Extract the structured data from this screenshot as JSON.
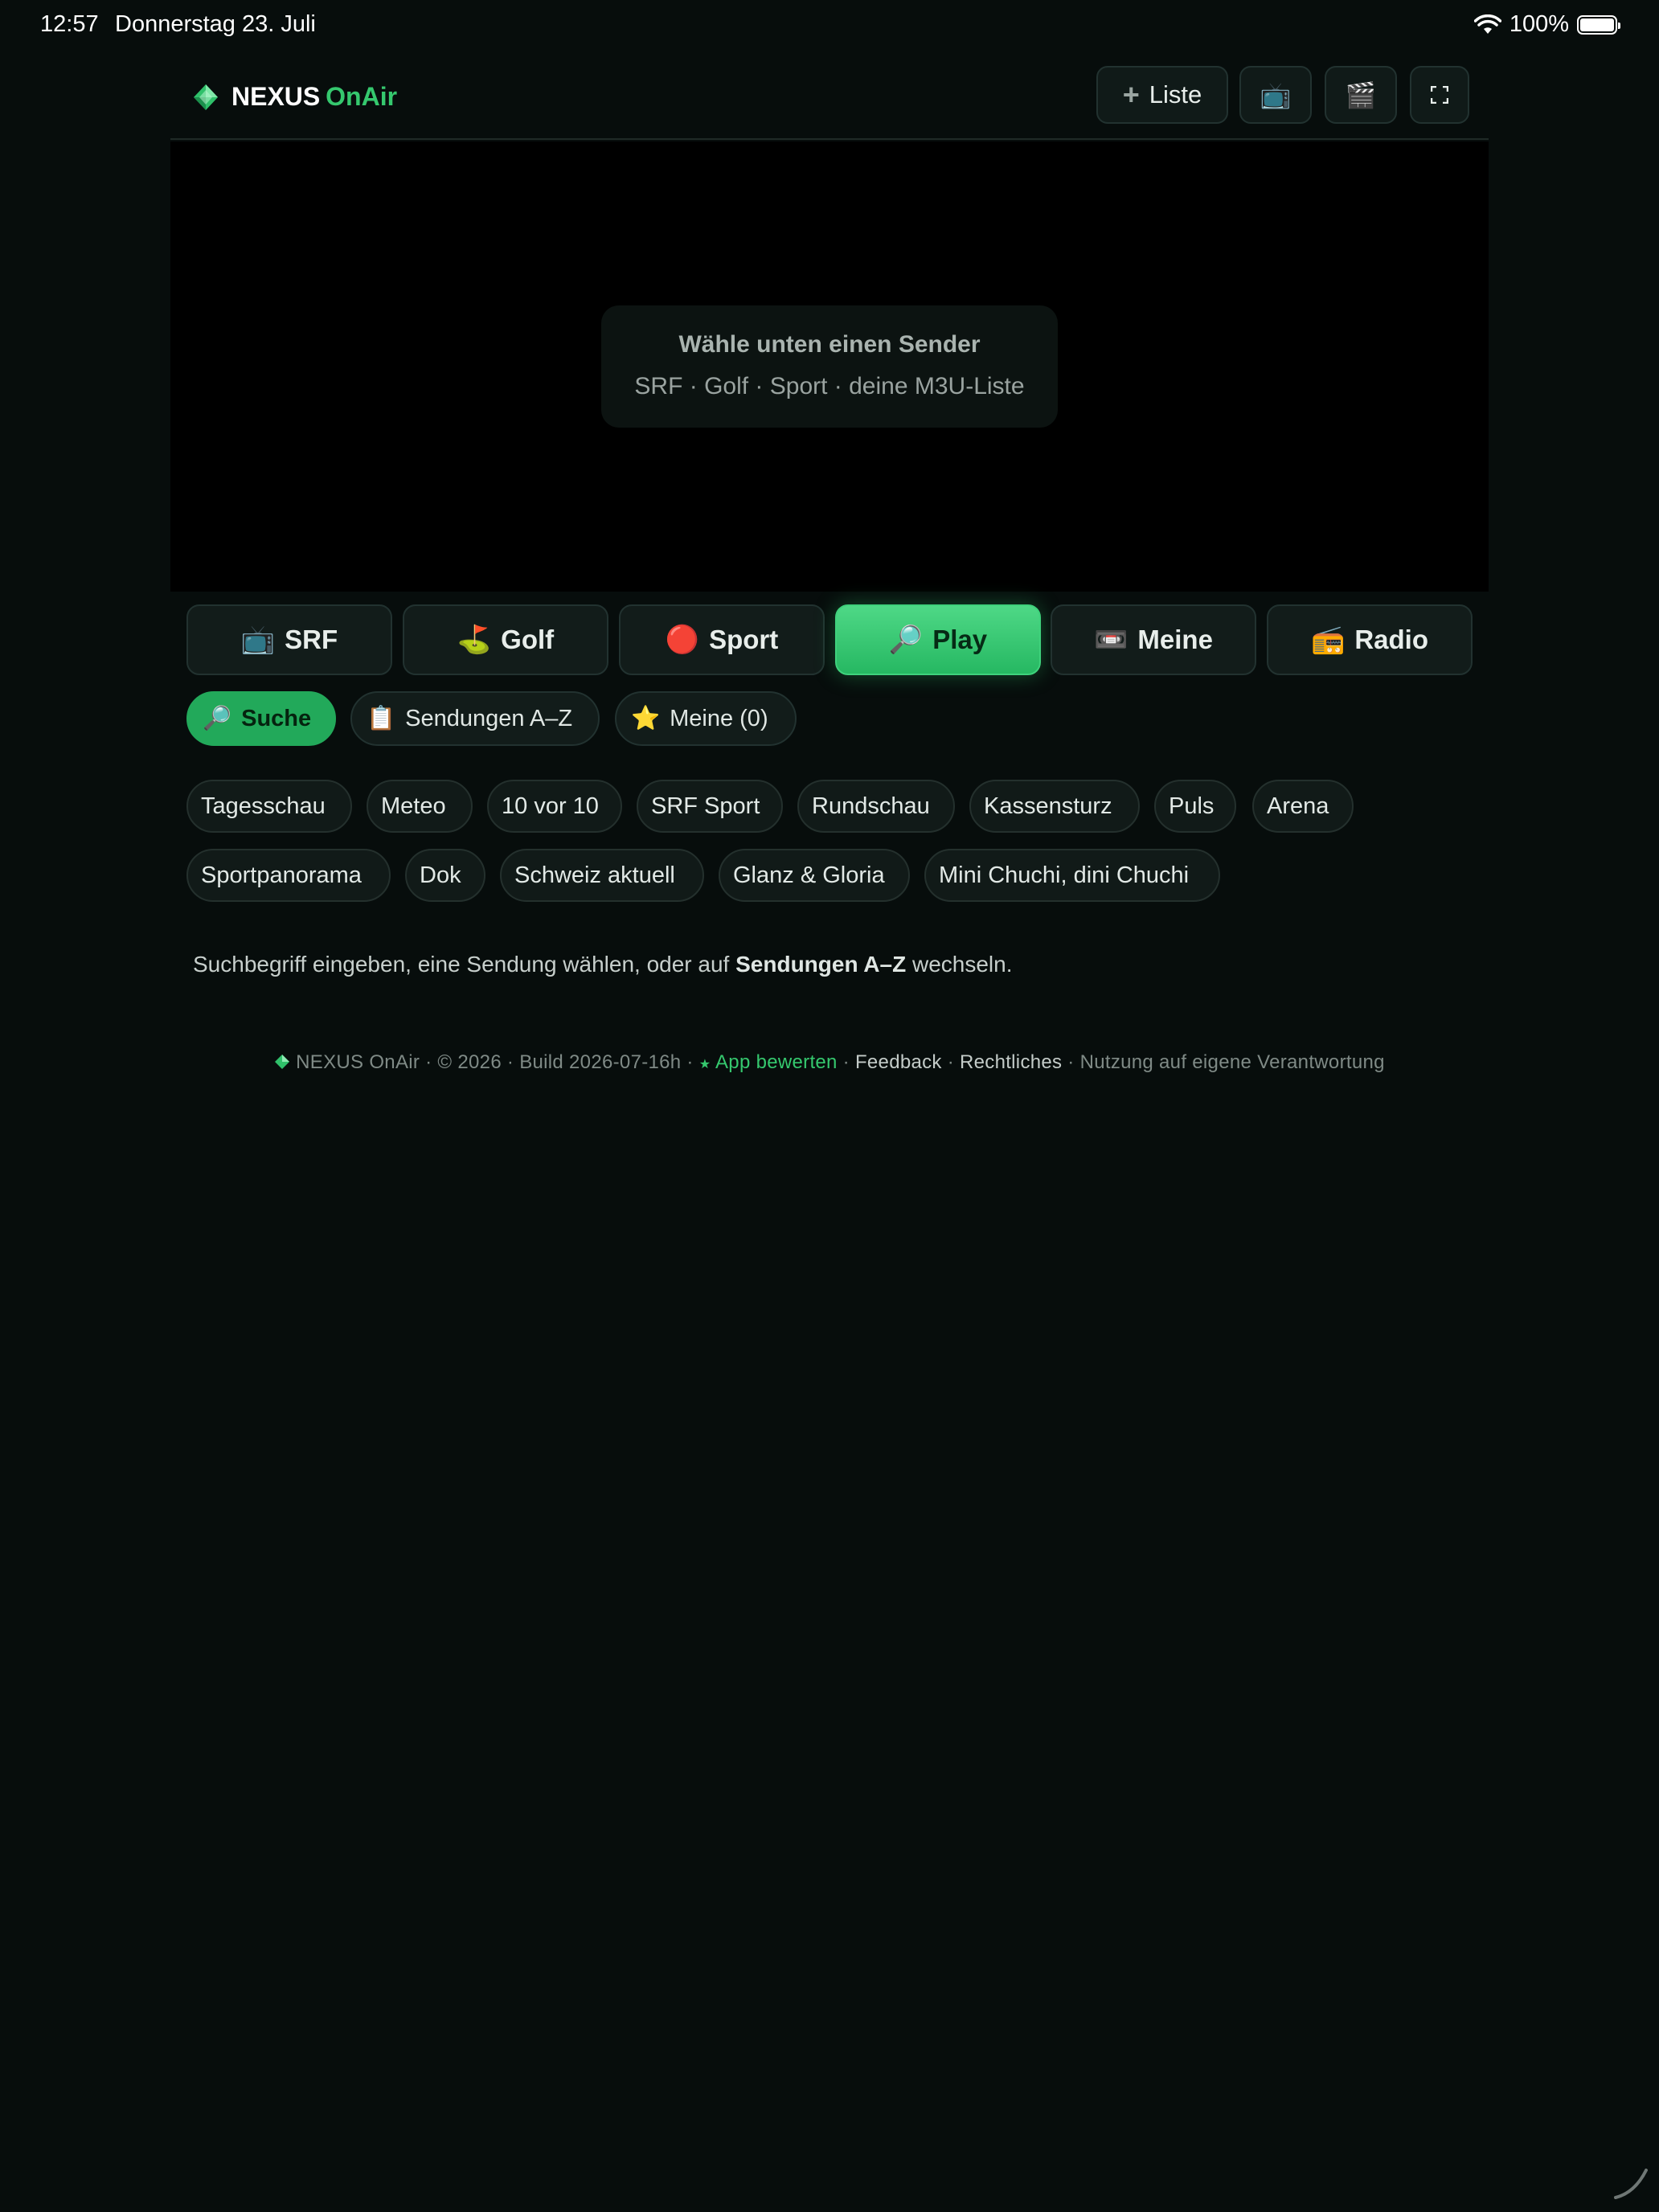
{
  "status_bar": {
    "time": "12:57",
    "date": "Donnerstag 23. Juli",
    "battery": "100%"
  },
  "header": {
    "logo_word1": "NEXUS",
    "logo_word2": "OnAir",
    "add_list_label": "Liste",
    "tv_icon_glyph": "📺",
    "clapper_icon_glyph": "🎬",
    "fullscreen_icon_glyph": "⛶"
  },
  "player": {
    "title": "Wähle unten einen Sender",
    "subtitle": "SRF · Golf · Sport · deine M3U-Liste"
  },
  "tabs": [
    {
      "icon": "📺",
      "label": "SRF"
    },
    {
      "icon": "⛳",
      "label": "Golf"
    },
    {
      "icon": "🔴",
      "label": "Sport"
    },
    {
      "icon": "🔎",
      "label": "Play"
    },
    {
      "icon": "📼",
      "label": "Meine"
    },
    {
      "icon": "📻",
      "label": "Radio"
    }
  ],
  "active_tab": "Play",
  "subtabs": [
    {
      "icon": "🔎",
      "label": "Suche"
    },
    {
      "icon": "📋",
      "label": "Sendungen A–Z"
    },
    {
      "icon": "⭐",
      "label": "Meine (0)"
    }
  ],
  "active_subtab": "Suche",
  "shows": [
    "Tagesschau",
    "Meteo",
    "10 vor 10",
    "SRF Sport",
    "Rundschau",
    "Kassensturz",
    "Puls",
    "Arena",
    "Sportpanorama",
    "Dok",
    "Schweiz aktuell",
    "Glanz & Gloria",
    "Mini Chuchi, dini Chuchi"
  ],
  "hint": {
    "before": "Suchbegriff eingeben, eine Sendung wählen, oder auf ",
    "bold": "Sendungen A–Z",
    "after": " wechseln."
  },
  "footer": {
    "brand": "NEXUS OnAir",
    "copyright": "© 2026",
    "build": "Build 2026-07-16h",
    "rate_star": "★",
    "rate": "App bewerten",
    "feedback": "Feedback",
    "legal": "Rechtliches",
    "disclaimer": "Nutzung auf eigene Verantwortung",
    "separator": " · "
  },
  "colors": {
    "accent": "#35c86e",
    "background": "#070d0c",
    "surface": "#121c1a",
    "border": "#223230"
  }
}
